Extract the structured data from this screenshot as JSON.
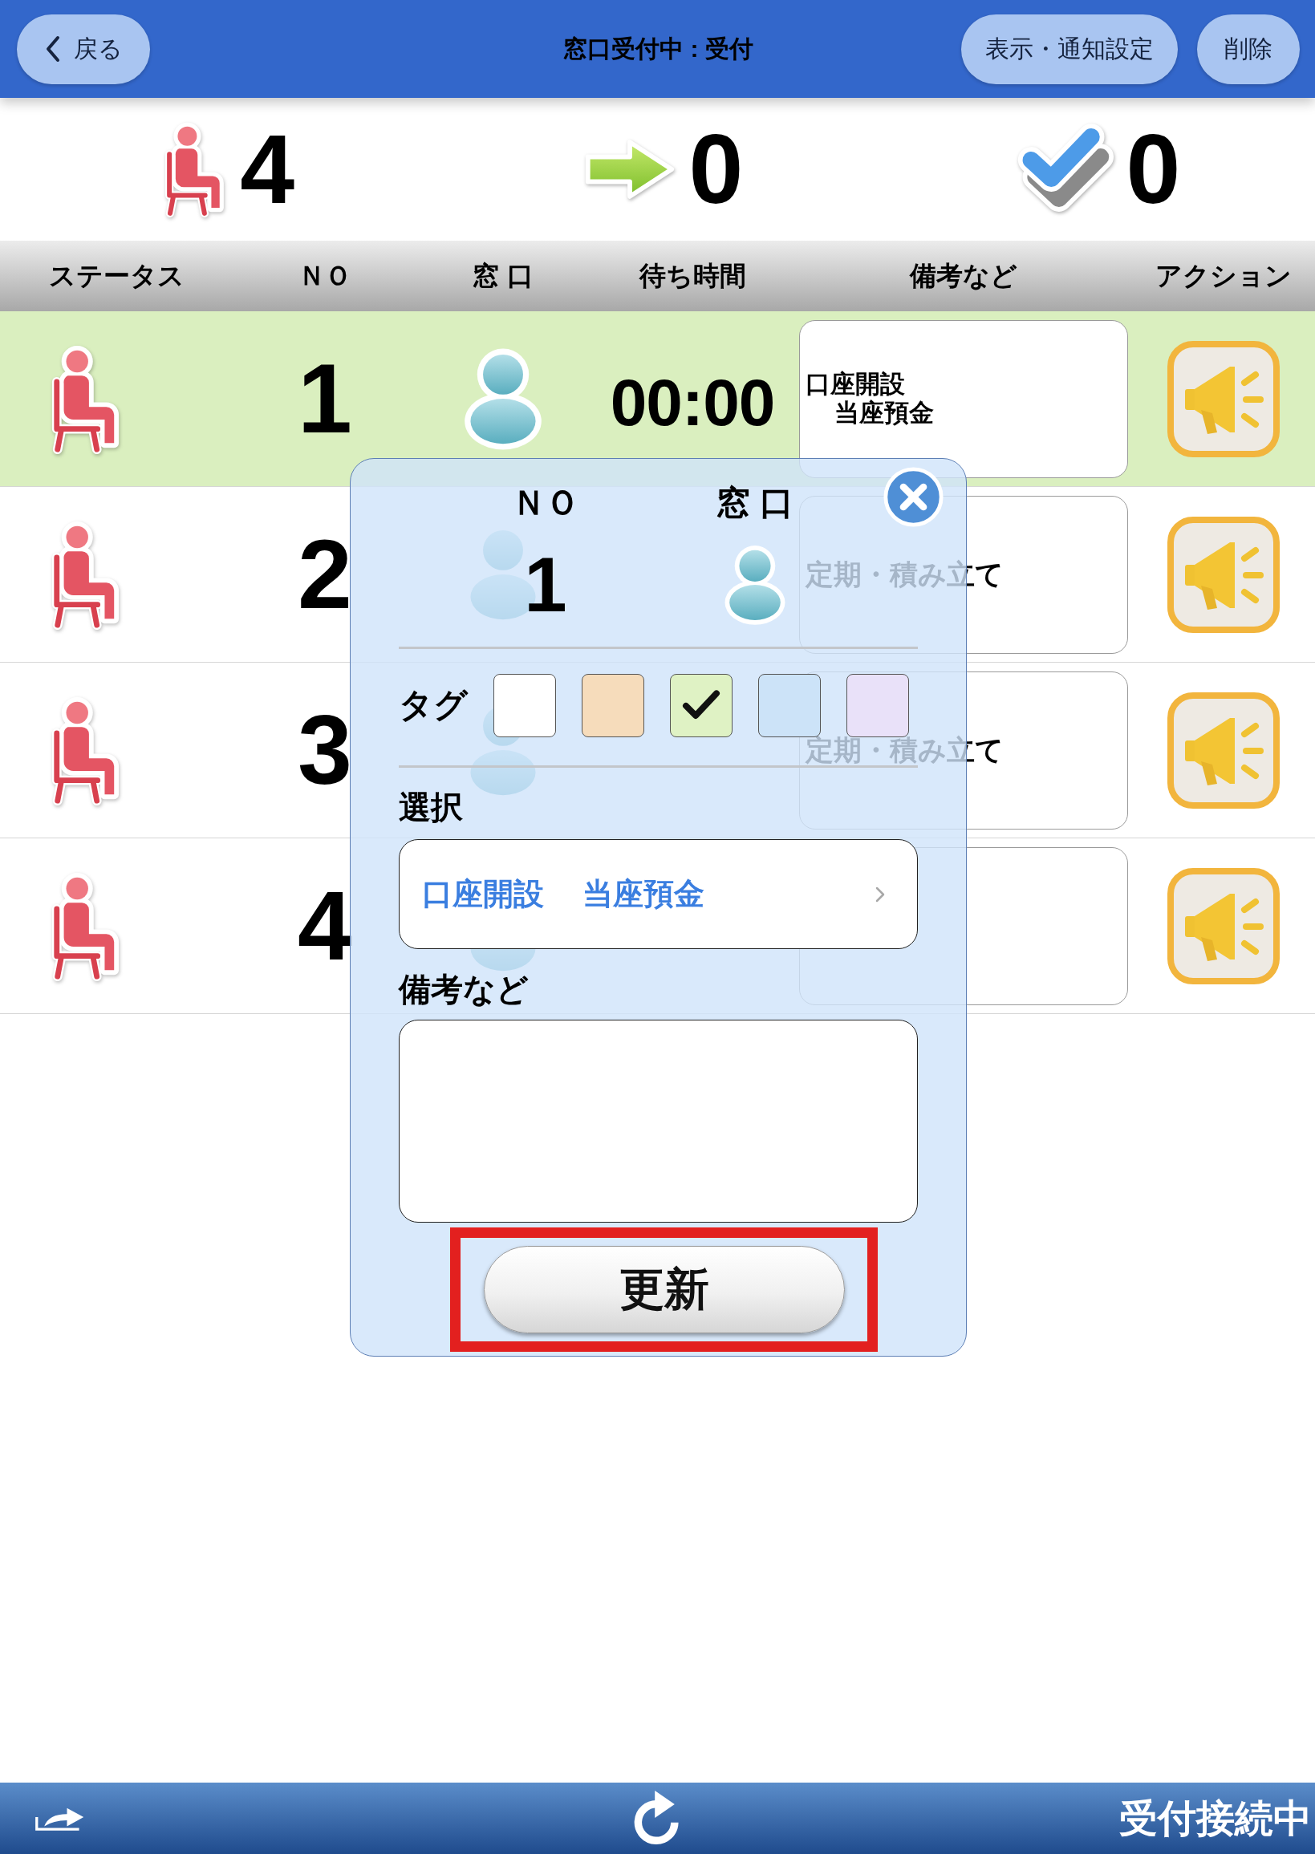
{
  "header": {
    "back_button": "戻る",
    "title": "窓口受付中 : 受付",
    "buttons": [
      "表示・通知設定",
      "削除"
    ]
  },
  "summary": [
    {
      "kind": "waiting",
      "count": "4"
    },
    {
      "kind": "called",
      "count": "0"
    },
    {
      "kind": "done",
      "count": "0"
    }
  ],
  "table": {
    "columns": [
      "ステータス",
      "ＮＯ",
      "窓 口",
      "待ち時間",
      "備考など",
      "アクション"
    ],
    "rows": [
      {
        "selected": true,
        "kind": "waiting",
        "no": "1",
        "wait_time": "00:00",
        "remarks": [
          "口座開設",
          "当座預金"
        ]
      },
      {
        "selected": false,
        "kind": "waiting",
        "no": "2",
        "remarks": [
          "定期・積み立て"
        ]
      },
      {
        "selected": false,
        "kind": "waiting",
        "no": "3",
        "remarks": [
          "定期・積み立て"
        ]
      },
      {
        "selected": false,
        "kind": "waiting",
        "no": "4"
      }
    ]
  },
  "popup": {
    "columns": [
      "ＮＯ",
      "窓 口"
    ],
    "no": "1",
    "tag_label": "タグ",
    "tags": [
      {
        "color": "#ffffff",
        "checked": false
      },
      {
        "color": "#f6dcbb",
        "checked": false
      },
      {
        "color": "#dff2c4",
        "checked": true
      },
      {
        "color": "#cce3f8",
        "checked": false
      },
      {
        "color": "#e9e1f9",
        "checked": false
      }
    ],
    "selection_label": "選択",
    "selection": [
      "口座開設",
      "当座預金"
    ],
    "notes_label": "備考など",
    "update_button": {
      "label": "更新",
      "highlighted": true
    }
  },
  "status_bar": {
    "text": "受付接続中"
  }
}
